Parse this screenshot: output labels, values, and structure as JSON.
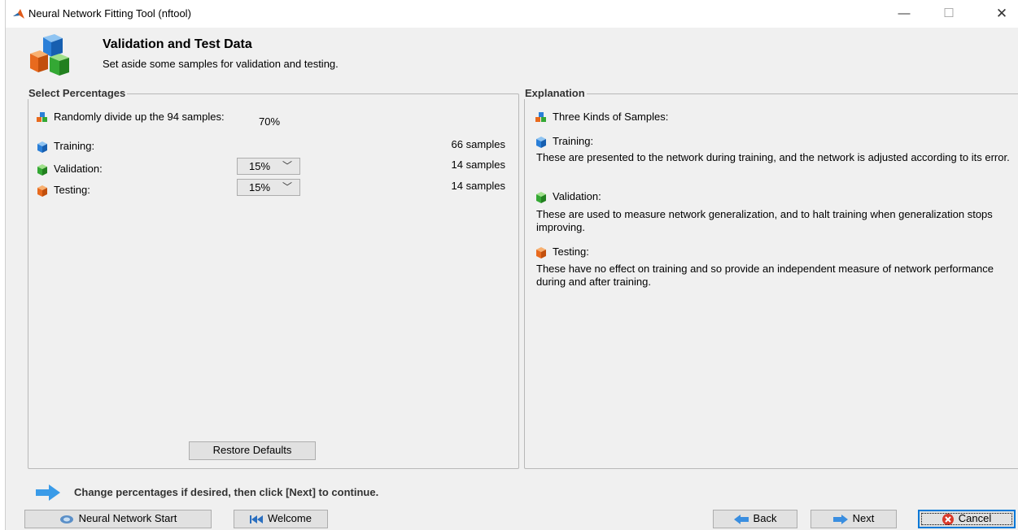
{
  "window": {
    "title": "Neural Network Fitting Tool (nftool)",
    "controls": {
      "minimize": "—",
      "maximize": "☐",
      "close": "✕"
    }
  },
  "header": {
    "title": "Validation and Test Data",
    "subtitle": "Set aside some samples for validation and testing."
  },
  "left_panel": {
    "legend": "Select Percentages",
    "intro": "Randomly divide up the 94 samples:",
    "rows": [
      {
        "label": "Training:",
        "percent": "70%",
        "samples": "66 samples",
        "editable": false,
        "color": "#1e78d2"
      },
      {
        "label": "Validation:",
        "percent": "15%",
        "samples": "14 samples",
        "editable": true,
        "color": "#2aa52a"
      },
      {
        "label": "Testing:",
        "percent": "15%",
        "samples": "14 samples",
        "editable": true,
        "color": "#e8661e"
      }
    ],
    "restore_button": "Restore Defaults"
  },
  "right_panel": {
    "legend": "Explanation",
    "intro": "Three Kinds of Samples:",
    "sections": [
      {
        "heading": "Training:",
        "text": "These are presented to the network during training, and the network is adjusted according to its error."
      },
      {
        "heading": "Validation:",
        "text": "These are used to measure network generalization, and to halt training when generalization stops improving."
      },
      {
        "heading": "Testing:",
        "text": "These have no effect on training and so provide an independent measure of network performance during and after training."
      }
    ]
  },
  "hint": "Change percentages if desired, then click [Next] to continue.",
  "bottom_buttons": {
    "start": "Neural Network Start",
    "welcome": "Welcome",
    "back": "Back",
    "next": "Next",
    "cancel": "Cancel"
  },
  "icons": {
    "app": "matlab-logo-icon",
    "header": "cubes-icon",
    "dropdown": "chevron-down-icon"
  }
}
